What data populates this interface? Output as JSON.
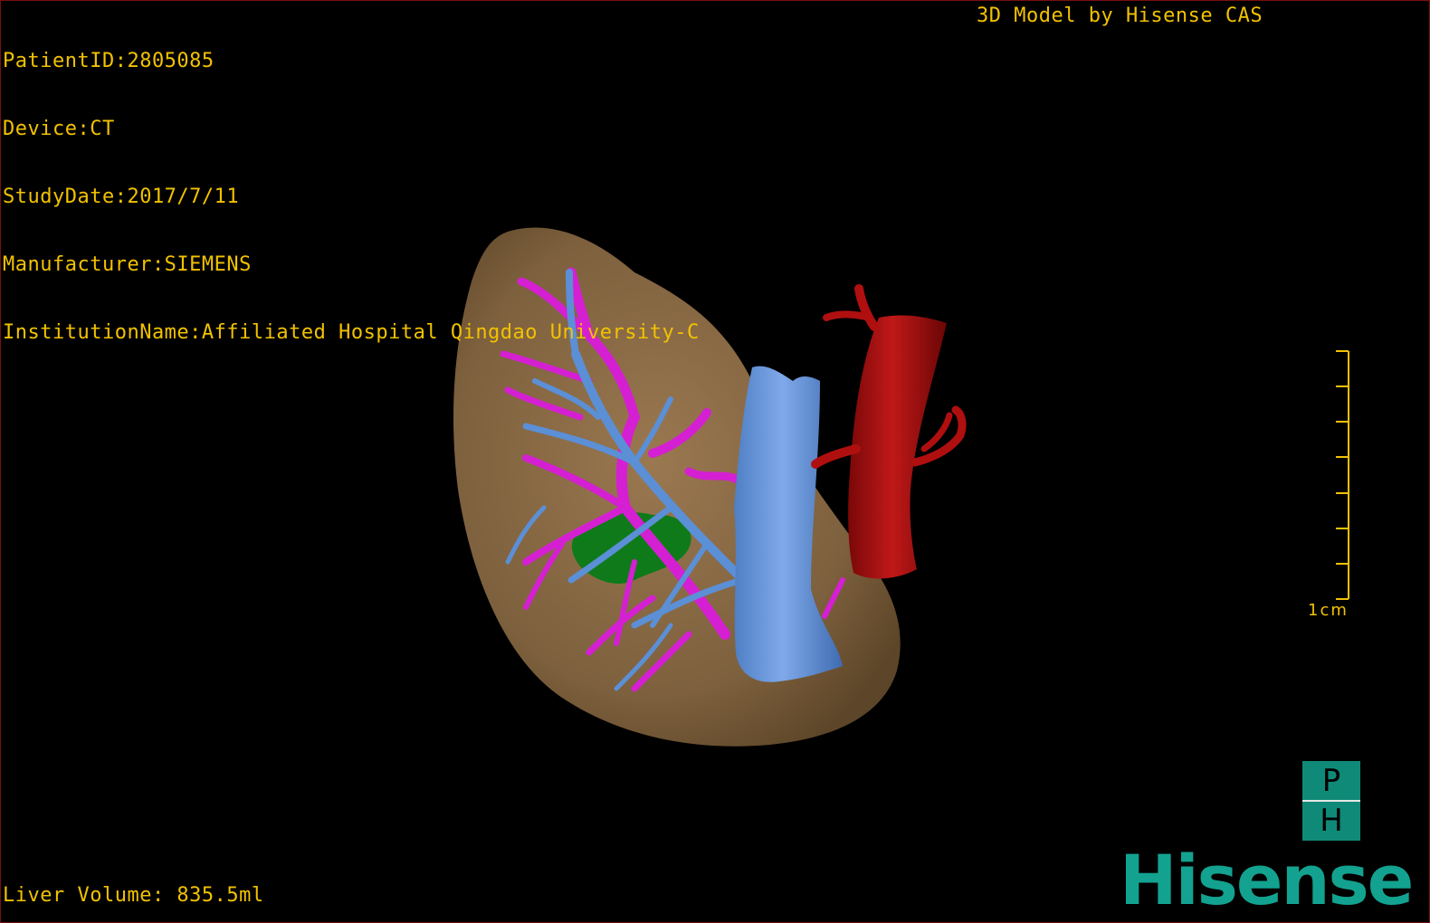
{
  "overlay": {
    "patient_lines": [
      "PatientID:2805085",
      "Device:CT",
      "StudyDate:2017/7/11",
      "Manufacturer:SIEMENS",
      "InstitutionName:Affiliated Hospital Qingdao University-C"
    ],
    "model_credit": "3D Model by Hisense CAS",
    "liver_volume": "Liver Volume: 835.5ml",
    "scale_label": "1cm"
  },
  "logo": {
    "ph_top": "P",
    "ph_bottom": "H",
    "brand": "Hisense"
  },
  "colors": {
    "background": "#000000",
    "overlay_text": "#f2c200",
    "frame_border": "#7a0f0f",
    "liver": "#8a6a45",
    "portal_vein": "#d51fd2",
    "hepatic_vein": "#5b8fd6",
    "vena_cava": "#6a9ae0",
    "aorta": "#b00f0f",
    "gallbladder_tumor": "#0f7a1a",
    "brand": "#13a290"
  },
  "scene_objects": [
    "liver",
    "portal-vein",
    "hepatic-vein",
    "vena-cava",
    "aorta",
    "green-lesion"
  ]
}
